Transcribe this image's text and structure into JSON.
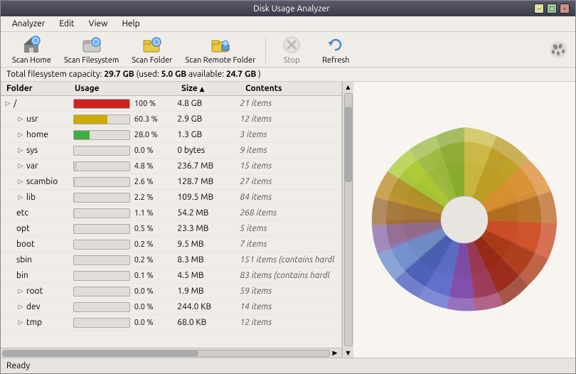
{
  "titlebar": {
    "title": "Disk Usage Analyzer",
    "min_label": "–",
    "max_label": "□",
    "close_label": "×"
  },
  "menubar": {
    "items": [
      {
        "label": "Analyzer"
      },
      {
        "label": "Edit"
      },
      {
        "label": "View"
      },
      {
        "label": "Help"
      }
    ]
  },
  "toolbar": {
    "buttons": [
      {
        "id": "scan-home",
        "label": "Scan Home",
        "enabled": true
      },
      {
        "id": "scan-filesystem",
        "label": "Scan Filesystem",
        "enabled": true
      },
      {
        "id": "scan-folder",
        "label": "Scan Folder",
        "enabled": true
      },
      {
        "id": "scan-remote",
        "label": "Scan Remote Folder",
        "enabled": true
      },
      {
        "id": "stop",
        "label": "Stop",
        "enabled": false
      },
      {
        "id": "refresh",
        "label": "Refresh",
        "enabled": true
      }
    ]
  },
  "statusinfo": {
    "text": "Total filesystem capacity: ",
    "capacity": "29.7 GB",
    "used_label": " (used: ",
    "used": "5.0 GB",
    "available_label": " available: ",
    "available": "24.7 GB",
    "close_paren": " )"
  },
  "table": {
    "headers": {
      "folder": "Folder",
      "usage": "Usage",
      "size": "Size",
      "size_sort": "▲",
      "contents": "Contents"
    },
    "rows": [
      {
        "indent": 0,
        "expand": true,
        "name": "/",
        "bar_pct": 100,
        "bar_color": "#cc2222",
        "pct": "100 %",
        "size": "4.8 GB",
        "contents": "21 items",
        "italic": false
      },
      {
        "indent": 1,
        "expand": true,
        "name": "usr",
        "bar_pct": 60,
        "bar_color": "#ccaa00",
        "pct": "60.3 %",
        "size": "2.9 GB",
        "contents": "12 items",
        "italic": false
      },
      {
        "indent": 1,
        "expand": true,
        "name": "home",
        "bar_pct": 28,
        "bar_color": "#44aa44",
        "pct": "28.0 %",
        "size": "1.3 GB",
        "contents": "3 items",
        "italic": false
      },
      {
        "indent": 1,
        "expand": true,
        "name": "sys",
        "bar_pct": 0,
        "bar_color": "#dddddd",
        "pct": "0.0 %",
        "size": "0 bytes",
        "contents": "9 items",
        "italic": false
      },
      {
        "indent": 1,
        "expand": true,
        "name": "var",
        "bar_pct": 5,
        "bar_color": "#cccccc",
        "pct": "4.8 %",
        "size": "236.7 MB",
        "contents": "15 items",
        "italic": false
      },
      {
        "indent": 1,
        "expand": true,
        "name": "scambio",
        "bar_pct": 3,
        "bar_color": "#cccccc",
        "pct": "2.6 %",
        "size": "128.7 MB",
        "contents": "27 items",
        "italic": false
      },
      {
        "indent": 1,
        "expand": true,
        "name": "lib",
        "bar_pct": 2,
        "bar_color": "#cccccc",
        "pct": "2.2 %",
        "size": "109.5 MB",
        "contents": "84 items",
        "italic": false
      },
      {
        "indent": 1,
        "expand": false,
        "name": "etc",
        "bar_pct": 1,
        "bar_color": "#cccccc",
        "pct": "1.1 %",
        "size": "54.2 MB",
        "contents": "268 items",
        "italic": false
      },
      {
        "indent": 1,
        "expand": false,
        "name": "opt",
        "bar_pct": 1,
        "bar_color": "#cccccc",
        "pct": "0.5 %",
        "size": "23.3 MB",
        "contents": "5 items",
        "italic": false
      },
      {
        "indent": 1,
        "expand": false,
        "name": "boot",
        "bar_pct": 0,
        "bar_color": "#cccccc",
        "pct": "0.2 %",
        "size": "9.5 MB",
        "contents": "7 items",
        "italic": false
      },
      {
        "indent": 1,
        "expand": false,
        "name": "sbin",
        "bar_pct": 0,
        "bar_color": "#cccccc",
        "pct": "0.2 %",
        "size": "8.3 MB",
        "contents": "151 items  (contains hardl",
        "italic": true
      },
      {
        "indent": 1,
        "expand": false,
        "name": "bin",
        "bar_pct": 0,
        "bar_color": "#cccccc",
        "pct": "0.1 %",
        "size": "4.5 MB",
        "contents": "83 items  (contains hardl",
        "italic": true
      },
      {
        "indent": 1,
        "expand": true,
        "name": "root",
        "bar_pct": 0,
        "bar_color": "#cccccc",
        "pct": "0.0 %",
        "size": "1.9 MB",
        "contents": "59 items",
        "italic": false
      },
      {
        "indent": 1,
        "expand": true,
        "name": "dev",
        "bar_pct": 0,
        "bar_color": "#cccccc",
        "pct": "0.0 %",
        "size": "244.0 KB",
        "contents": "14 items",
        "italic": false
      },
      {
        "indent": 1,
        "expand": true,
        "name": "tmp",
        "bar_pct": 0,
        "bar_color": "#cccccc",
        "pct": "0.0 %",
        "size": "68.0 KB",
        "contents": "12 items",
        "italic": false
      }
    ]
  },
  "bottombar": {
    "status": "Ready"
  }
}
